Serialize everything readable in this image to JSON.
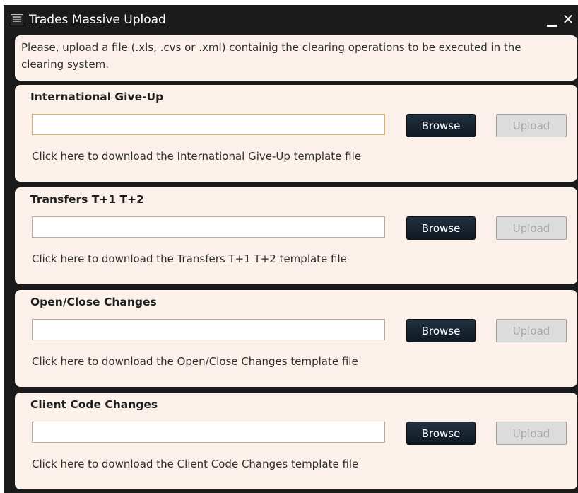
{
  "window": {
    "title": "Trades Massive Upload",
    "controls": {
      "minimize_icon": "minimize-icon",
      "close_icon": "close-icon"
    }
  },
  "info": {
    "text": "Please, upload a file (.xls, .cvs or .xml) containig the clearing operations to be executed in the clearing system."
  },
  "sections": [
    {
      "title": "International Give-Up",
      "file_value": "",
      "browse_label": "Browse",
      "upload_label": "Upload",
      "upload_enabled": false,
      "link_text": "Click here to download the International Give-Up template file"
    },
    {
      "title": "Transfers T+1 T+2",
      "file_value": "",
      "browse_label": "Browse",
      "upload_label": "Upload",
      "upload_enabled": false,
      "link_text": "Click here to download the Transfers T+1 T+2 template file"
    },
    {
      "title": "Open/Close Changes",
      "file_value": "",
      "browse_label": "Browse",
      "upload_label": "Upload",
      "upload_enabled": false,
      "link_text": "Click here to download the Open/Close Changes template file"
    },
    {
      "title": "Client Code Changes",
      "file_value": "",
      "browse_label": "Browse",
      "upload_label": "Upload",
      "upload_enabled": false,
      "link_text": "Click here to download the Client Code Changes template file"
    }
  ],
  "colors": {
    "titlebar": "#1b1b1b",
    "panel_bg": "#fbf1ea",
    "browse_button": "#15202b",
    "upload_disabled": "#dcdcdc"
  }
}
